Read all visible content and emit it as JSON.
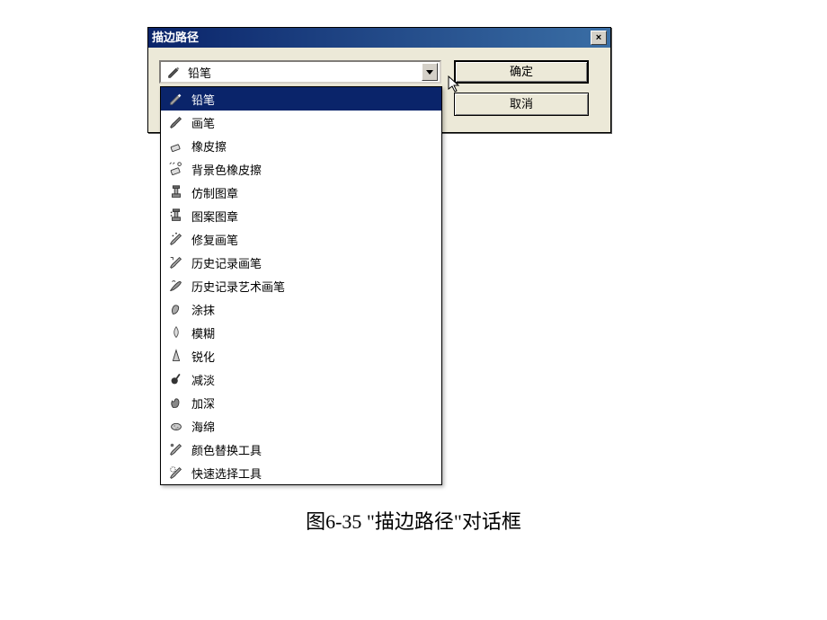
{
  "dialog": {
    "title": "描边路径",
    "close_label": "×",
    "selected_value": "铅笔",
    "ok_label": "确定",
    "cancel_label": "取消"
  },
  "dropdown": {
    "items": [
      {
        "label": "铅笔",
        "icon": "pencil",
        "selected": true
      },
      {
        "label": "画笔",
        "icon": "brush",
        "selected": false
      },
      {
        "label": "橡皮擦",
        "icon": "eraser",
        "selected": false
      },
      {
        "label": "背景色橡皮擦",
        "icon": "bg-eraser",
        "selected": false
      },
      {
        "label": "仿制图章",
        "icon": "clone-stamp",
        "selected": false
      },
      {
        "label": "图案图章",
        "icon": "pattern-stamp",
        "selected": false
      },
      {
        "label": "修复画笔",
        "icon": "healing-brush",
        "selected": false
      },
      {
        "label": "历史记录画笔",
        "icon": "history-brush",
        "selected": false
      },
      {
        "label": "历史记录艺术画笔",
        "icon": "art-history-brush",
        "selected": false
      },
      {
        "label": "涂抹",
        "icon": "smudge",
        "selected": false
      },
      {
        "label": "模糊",
        "icon": "blur",
        "selected": false
      },
      {
        "label": "锐化",
        "icon": "sharpen",
        "selected": false
      },
      {
        "label": "减淡",
        "icon": "dodge",
        "selected": false
      },
      {
        "label": "加深",
        "icon": "burn",
        "selected": false
      },
      {
        "label": "海绵",
        "icon": "sponge",
        "selected": false
      },
      {
        "label": "颜色替换工具",
        "icon": "color-replace",
        "selected": false
      },
      {
        "label": "快速选择工具",
        "icon": "quick-select",
        "selected": false
      }
    ]
  },
  "caption": "图6-35 \"描边路径\"对话框"
}
